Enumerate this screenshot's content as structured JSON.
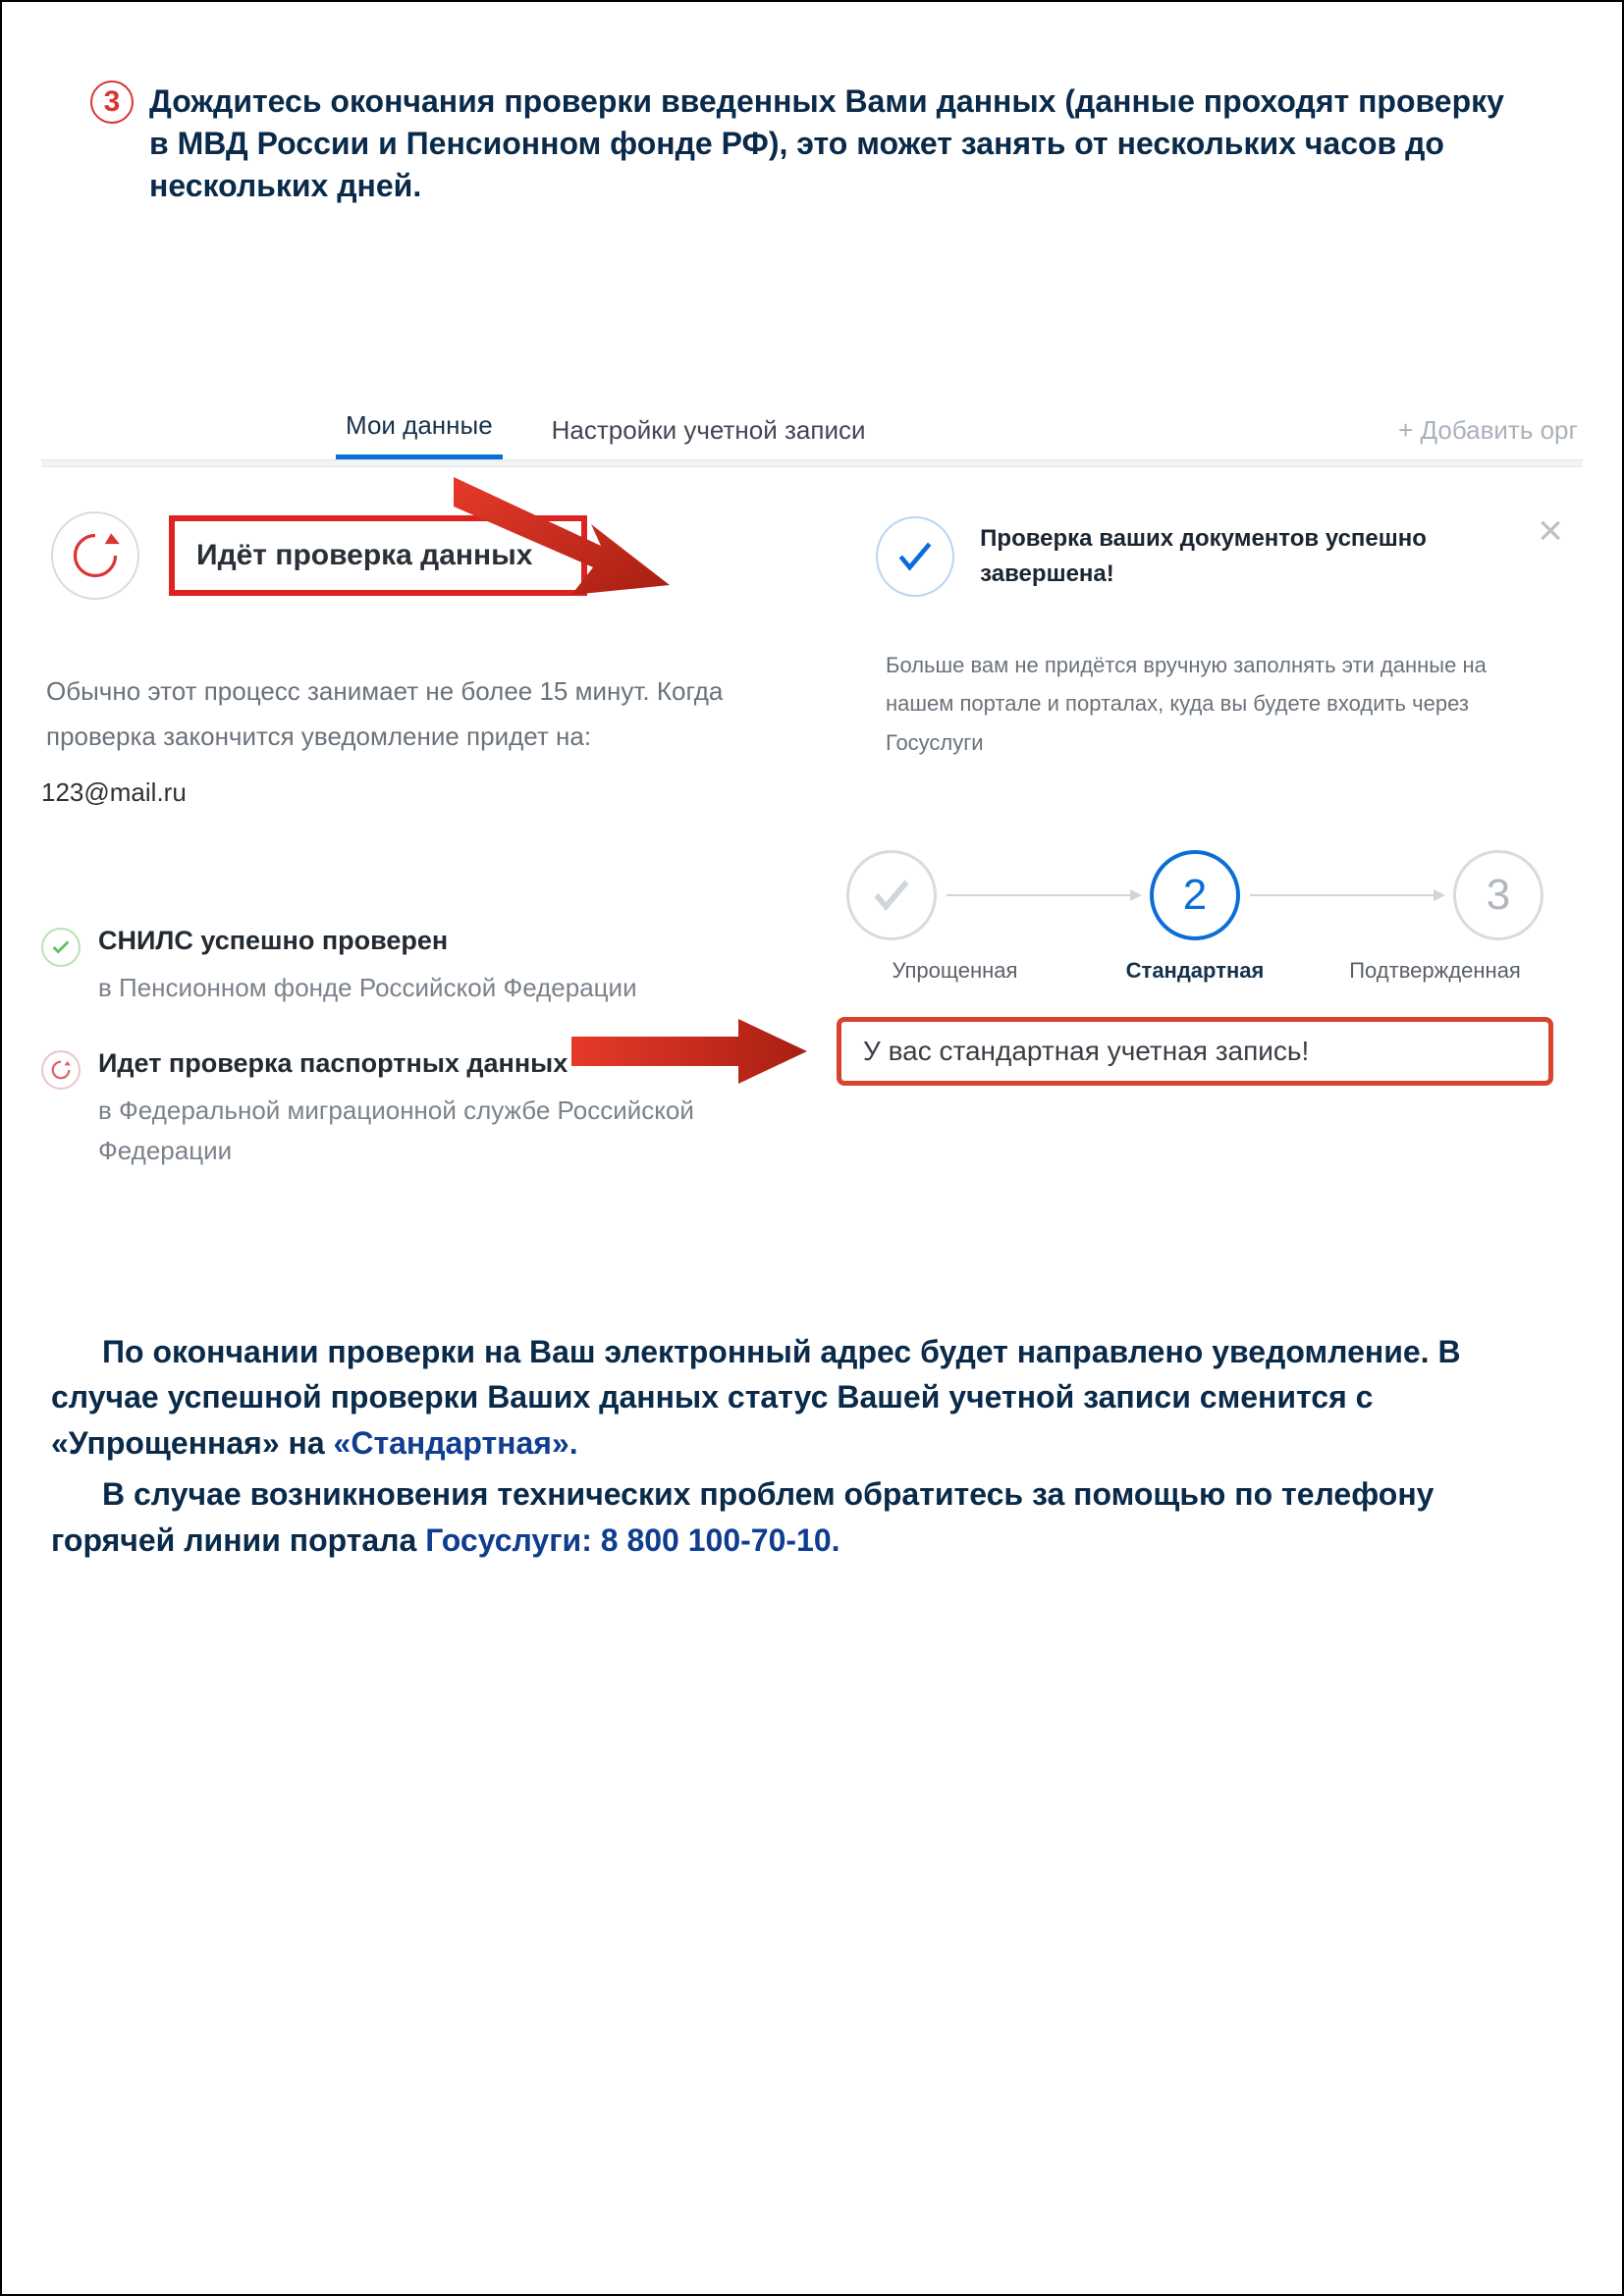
{
  "step": {
    "number": "3",
    "text": "Дождитесь окончания проверки введенных Вами данных (данные проходят проверку в МВД России и Пенсионном фонде РФ), это может занять от нескольких часов до нескольких дней."
  },
  "tabs": {
    "my_data": "Мои данные",
    "account_settings": "Настройки учетной записи",
    "add_org": "+ Добавить орг"
  },
  "left": {
    "title": "Идёт проверка данных",
    "desc": "Обычно этот процесс занимает не более 15 минут. Когда проверка закончится уведомление придет на:",
    "email": "123@mail.ru",
    "snils_title": "СНИЛС успешно проверен",
    "snils_sub": "в Пенсионном фонде Российской Федерации",
    "passport_title": "Идет проверка паспортных данных",
    "passport_sub": "в Федеральной миграционной службе Российской Федерации"
  },
  "right_top": {
    "title": "Проверка ваших документов успешно завершена!",
    "desc": "Больше вам не придётся вручную заполнять эти данные на нашем портале и порталах, куда вы будете входить через Госуслуги"
  },
  "stepper": {
    "step2": "2",
    "step3": "3",
    "label1": "Упрощенная",
    "label2": "Стандартная",
    "label3": "Подтвержденная",
    "result": "У вас стандартная учетная запись!"
  },
  "footer": {
    "p1a": "По окончании проверки на Ваш электронный адрес будет направлено уведомление. В случае успешной проверки Ваших данных статус Вашей учетной записи сменится с «Упрощенная» на ",
    "p1b": "«Стандартная».",
    "p2a": "В случае возникновения технических проблем обратитесь за помощью по телефону горячей линии портала ",
    "p2b": "Госуслуги: 8 800 100-70-10."
  }
}
